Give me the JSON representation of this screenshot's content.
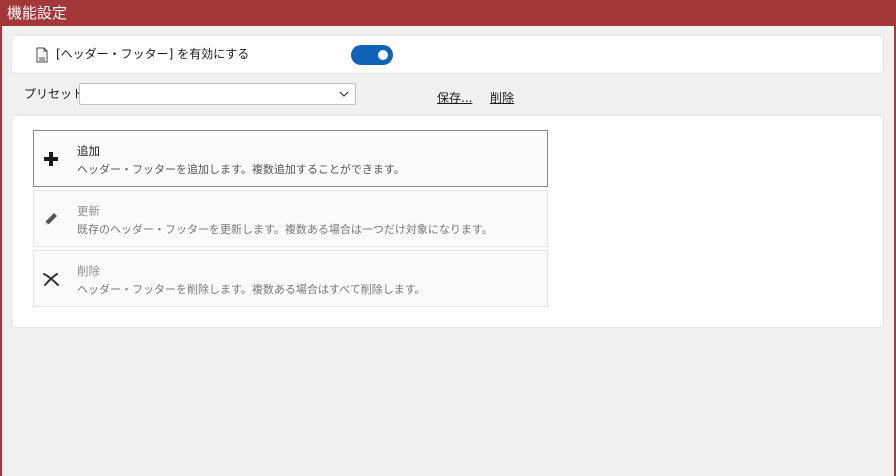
{
  "window": {
    "title": "機能設定"
  },
  "toggle": {
    "label": "[ヘッダー・フッター] を有効にする",
    "enabled": true,
    "icon": "document-icon"
  },
  "preset": {
    "label": "プリセット：",
    "value": "",
    "save_label": "保存...",
    "delete_label": "削除"
  },
  "actions": [
    {
      "title": "追加",
      "description": "ヘッダー・フッターを追加します。複数追加することができます。",
      "icon": "plus-icon",
      "enabled": true
    },
    {
      "title": "更新",
      "description": "既存のヘッダー・フッターを更新します。複数ある場合は一つだけ対象になります。",
      "icon": "pencil-icon",
      "enabled": false
    },
    {
      "title": "削除",
      "description": "ヘッダー・フッターを削除します。複数ある場合はすべて削除します。",
      "icon": "delete-x-icon",
      "enabled": false
    }
  ],
  "colors": {
    "titlebar": "#a4373a",
    "toggle_on": "#0f62b8",
    "background": "#f0f0f0"
  }
}
